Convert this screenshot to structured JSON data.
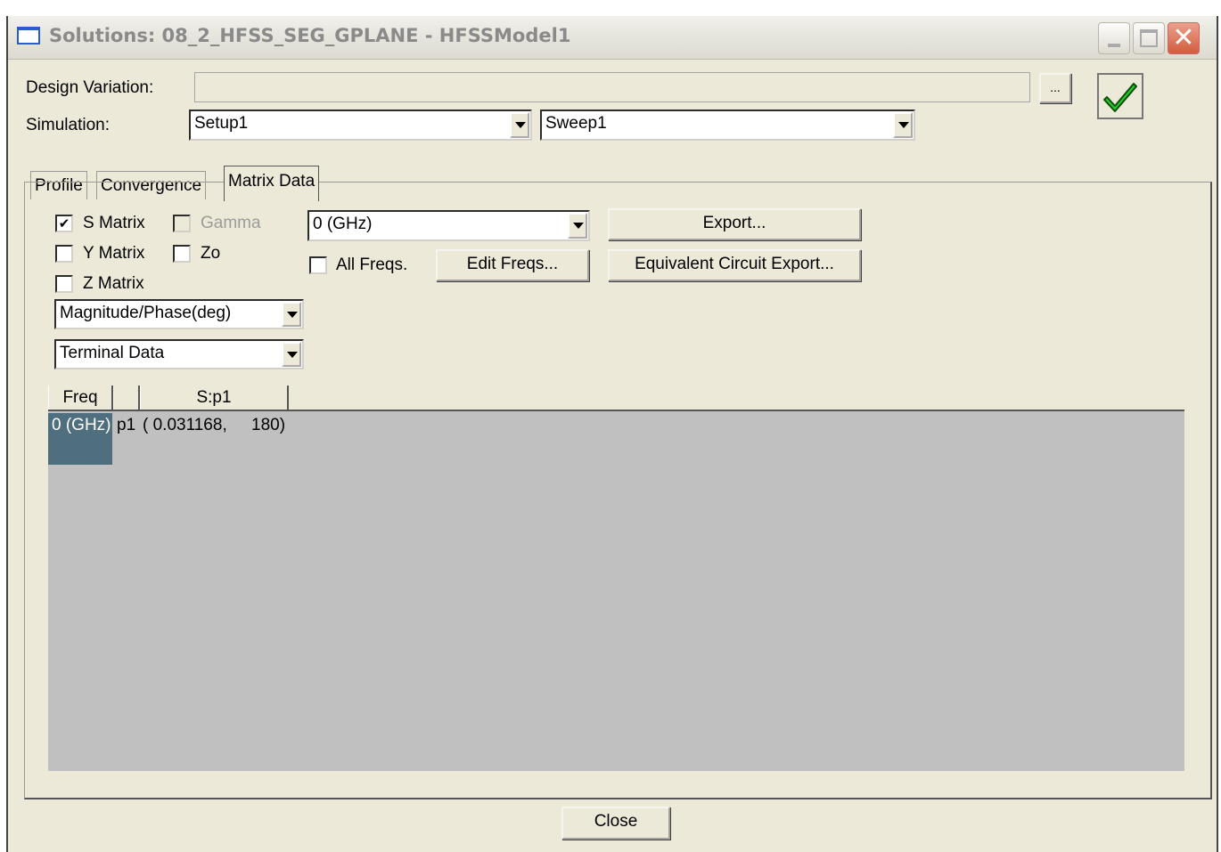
{
  "window": {
    "title": "Solutions: 08_2_HFSS_SEG_GPLANE - HFSSModel1"
  },
  "design_variation": {
    "label": "Design Variation:",
    "value": "",
    "browse_label": "..."
  },
  "simulation": {
    "label": "Simulation:",
    "setup": "Setup1",
    "sweep": "Sweep1"
  },
  "tabs": [
    {
      "label": "Profile"
    },
    {
      "label": "Convergence"
    },
    {
      "label": "Matrix Data",
      "active": true
    }
  ],
  "options": {
    "s_matrix": {
      "label": "S Matrix",
      "checked": true,
      "check_glyph": "✔"
    },
    "gamma": {
      "label": "Gamma",
      "checked": false,
      "disabled": true
    },
    "y_matrix": {
      "label": "Y Matrix",
      "checked": false
    },
    "zo": {
      "label": "Zo",
      "checked": false
    },
    "z_matrix": {
      "label": "Z Matrix",
      "checked": false
    },
    "all_freqs": {
      "label": "All Freqs.",
      "checked": false
    }
  },
  "format_select": {
    "value": "Magnitude/Phase(deg)"
  },
  "data_type_select": {
    "value": "Terminal Data"
  },
  "freq_select": {
    "value": "0 (GHz)"
  },
  "buttons": {
    "export": "Export...",
    "edit_freqs": "Edit Freqs...",
    "equiv_export": "Equivalent Circuit Export...",
    "close": "Close"
  },
  "grid": {
    "columns": [
      "Freq",
      "",
      "S:p1"
    ],
    "rows": [
      {
        "freq": "0 (GHz)",
        "port": "p1",
        "value": "( 0.031168,",
        "phase": "180)"
      }
    ]
  },
  "icons": {
    "ok_check": "green-check-icon",
    "window": "window-icon"
  },
  "colors": {
    "accept_green": "#22cc22",
    "selection": "#4f6f7e",
    "grid_bg": "#c0c0c0"
  }
}
